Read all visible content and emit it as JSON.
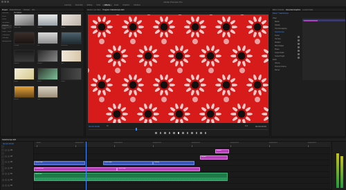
{
  "window": {
    "title": "Adobe Premiere Pro"
  },
  "menu": {
    "tabs": [
      "Learning",
      "Assembly",
      "Editing",
      "Color",
      "Effects",
      "Audio",
      "Graphics",
      "Libraries"
    ],
    "active_index": 4
  },
  "project_panel": {
    "tabs": [
      "Project",
      "Media Browser",
      "Libraries",
      "Info"
    ],
    "bins": [
      "Favorites",
      "Local",
      "Cloud",
      "Templates",
      "Graphics",
      "Titles",
      "Lower Thirds",
      "Transitions",
      "Overlays",
      "Backgrounds"
    ],
    "selected_bin_index": 4,
    "header_label": "Templates",
    "thumbnails": [
      {
        "caption": "Slide Intro"
      },
      {
        "caption": "Clouds"
      },
      {
        "caption": "Frame"
      },
      {
        "caption": "Vintage"
      },
      {
        "caption": "Ink"
      },
      {
        "caption": "Mountains"
      },
      {
        "caption": "Legend"
      },
      {
        "caption": "Smoke"
      },
      {
        "caption": "Split"
      },
      {
        "caption": "Bright"
      },
      {
        "caption": "Brush"
      },
      {
        "caption": "Loops"
      },
      {
        "caption": "Sunset"
      },
      {
        "caption": "Title"
      }
    ]
  },
  "monitor": {
    "tabs": [
      "Source: (no clips)",
      "Program: Kaleidoscope Edit"
    ],
    "timecode_left": "00:00:15:08",
    "timecode_right": "00:00:29:09",
    "fit_label": "Fit",
    "quality_label": "Full"
  },
  "effect_controls": {
    "tabs": [
      "Effect Controls",
      "Essential Graphics",
      "Lumetri Color"
    ],
    "clip_label": "Master * Kaleidoscope",
    "rows": [
      "Video",
      "Motion",
      "Opacity",
      "Time Remapping",
      "Kaleidoscope",
      "Center",
      "Tile Size",
      "Rotation",
      "Mirror Edges",
      "Phase",
      "Output Width",
      "Output Height",
      "Audio",
      "Volume",
      "Channel Volume",
      "Panner"
    ]
  },
  "timeline": {
    "sequence_tab": "Kaleidoscope Edit",
    "timecode": "00:00:15:08",
    "ruler_labels": [
      "00:00",
      "00:00:04:23",
      "00:00:09:23",
      "00:00:14:23",
      "00:00:19:23",
      "00:00:24:23",
      "00:00:29:23",
      "00:00:34:23"
    ],
    "tracks": [
      "V4",
      "V3",
      "V2",
      "V1",
      "A1",
      "A2",
      "A3"
    ],
    "clips": [
      {
        "name": "Clip 01.mp4"
      },
      {
        "name": "Kaleidoscope"
      },
      {
        "name": "Clip 02.mp4"
      },
      {
        "name": "Clip 03.mp4"
      },
      {
        "name": "Overlay"
      },
      {
        "name": "Graphic"
      },
      {
        "name": "Graphic"
      },
      {
        "name": "Music.wav"
      }
    ]
  },
  "colors": {
    "accent_blue": "#3b8cff",
    "clip_blue": "#3a56b8",
    "clip_pink": "#b43fb6",
    "clip_green": "#1f7a48",
    "viewer_red": "#d21616"
  }
}
